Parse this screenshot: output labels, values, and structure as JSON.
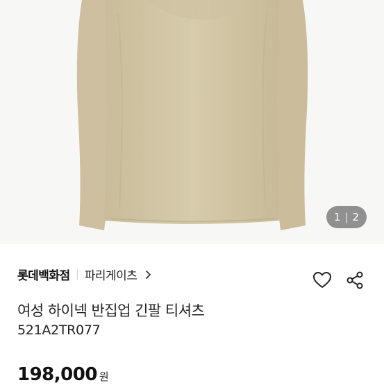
{
  "gallery": {
    "current": "1",
    "separator": "|",
    "total": "2"
  },
  "brand": {
    "name": "롯데백화점",
    "sub_brand": "파리게이츠"
  },
  "product": {
    "title": "여성 하이넥 반집업 긴팔 티셔츠",
    "model_code": "521A2TR077",
    "price": "198,000",
    "currency_unit": "원"
  },
  "icons": {
    "wishlist": "heart-icon",
    "share": "share-icon",
    "brand_link": "chevron-right-icon"
  },
  "colors": {
    "product_shirt": "#d3c6a6",
    "counter_bg": "#5a5a5a"
  }
}
